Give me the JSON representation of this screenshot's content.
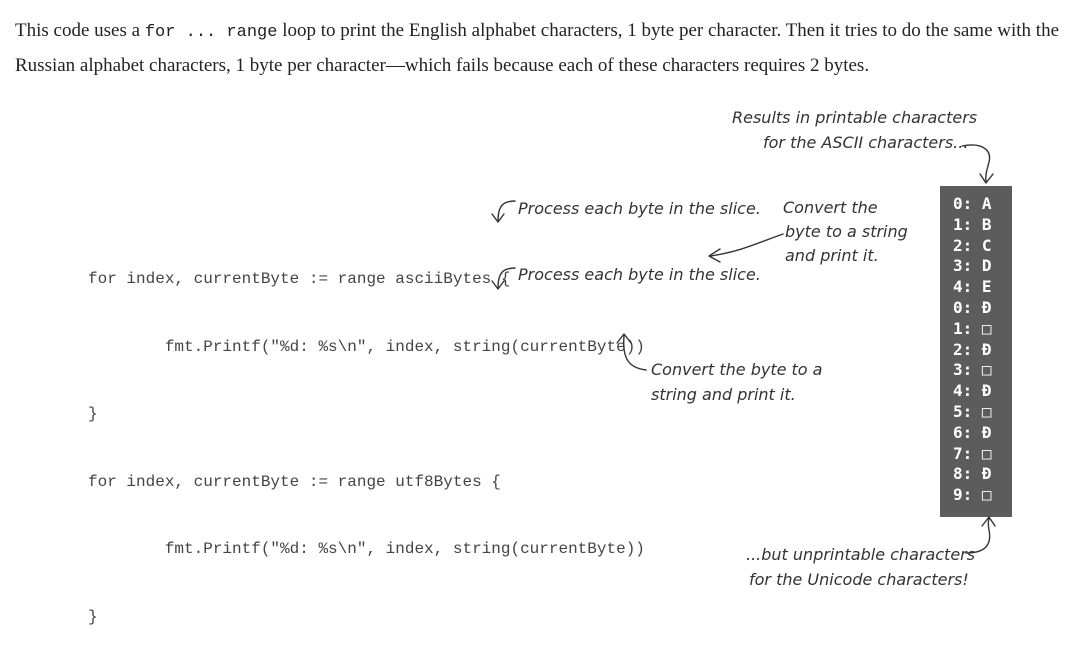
{
  "intro": {
    "text_1": "This code uses a ",
    "code_1": "for ... range",
    "text_2": " loop to print the English alphabet characters, 1 byte per character. Then it tries to do the same with the Russian alphabet characters, 1 byte per character—which fails because each of these characters requires 2 bytes."
  },
  "code_lines": [
    "for index, currentByte := range asciiBytes {",
    "        fmt.Printf(\"%d: %s\\n\", index, string(currentByte))",
    "}",
    "for index, currentByte := range utf8Bytes {",
    "        fmt.Printf(\"%d: %s\\n\", index, string(currentByte))",
    "}"
  ],
  "annotations": {
    "results_line1": "Results in printable characters",
    "results_line2": "for the ASCII characters...",
    "process_1": "Process each byte in the slice.",
    "process_2": "Process each byte in the slice.",
    "convert_top_line1": "Convert the",
    "convert_top_line2": "byte to a string",
    "convert_top_line3": "and print it.",
    "convert_bottom_line1": "Convert the byte to a",
    "convert_bottom_line2": "string and print it.",
    "unprintable_line1": "...but unprintable characters",
    "unprintable_line2": "for the Unicode characters!"
  },
  "output_lines": [
    "0: A",
    "1: B",
    "2: C",
    "3: D",
    "4: E",
    "0: Ð",
    "1: □",
    "2: Ð",
    "3: □",
    "4: Ð",
    "5: □",
    "6: Ð",
    "7: □",
    "8: Ð",
    "9: □"
  ]
}
